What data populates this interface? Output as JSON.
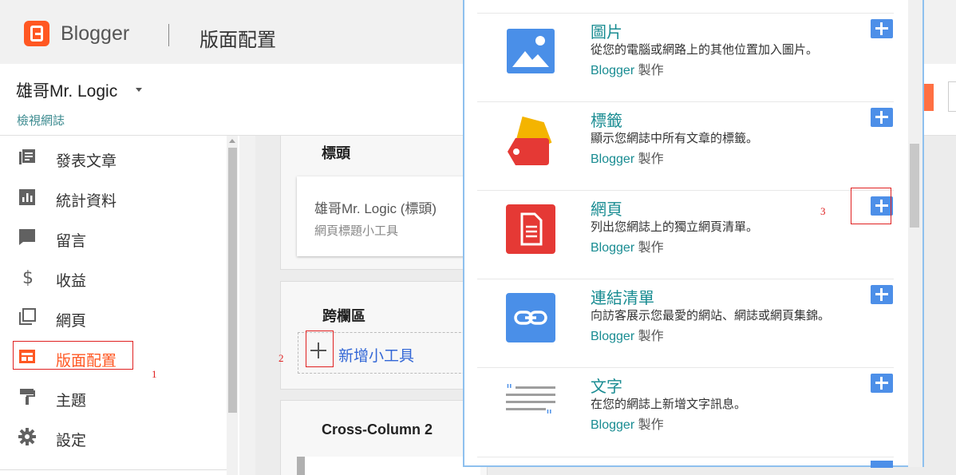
{
  "header": {
    "brand": "Blogger",
    "page_title": "版面配置"
  },
  "blog": {
    "name": "雄哥Mr. Logic",
    "view_blog": "檢視網誌"
  },
  "sidebar": {
    "items": [
      {
        "label": "發表文章",
        "icon": "posts-icon"
      },
      {
        "label": "統計資料",
        "icon": "stats-icon"
      },
      {
        "label": "留言",
        "icon": "comments-icon"
      },
      {
        "label": "收益",
        "icon": "dollar-icon"
      },
      {
        "label": "網頁",
        "icon": "pages-icon"
      },
      {
        "label": "版面配置",
        "icon": "layout-icon",
        "active": true
      },
      {
        "label": "主題",
        "icon": "theme-icon"
      },
      {
        "label": "設定",
        "icon": "gear-icon"
      }
    ]
  },
  "annotations": {
    "one": "1",
    "two": "2",
    "three": "3"
  },
  "layout": {
    "header_section": {
      "title": "標頭",
      "gadget_title": "雄哥Mr. Logic (標頭)",
      "gadget_subtitle": "網頁標題小工具"
    },
    "cross_column": {
      "title": "跨欄區",
      "add_gadget": "新增小工具"
    },
    "cross_column_2": {
      "title": "Cross-Column 2"
    }
  },
  "gadget_picker": {
    "items": [
      {
        "name": "圖片",
        "description": "從您的電腦或網路上的其他位置加入圖片。",
        "by": "Blogger",
        "made": "製作"
      },
      {
        "name": "標籤",
        "description": "顯示您網誌中所有文章的標籤。",
        "by": "Blogger",
        "made": "製作"
      },
      {
        "name": "網頁",
        "description": "列出您網誌上的獨立網頁清單。",
        "by": "Blogger",
        "made": "製作"
      },
      {
        "name": "連結清單",
        "description": "向訪客展示您最愛的網站、網誌或網頁集錦。",
        "by": "Blogger",
        "made": "製作"
      },
      {
        "name": "文字",
        "description": "在您的網誌上新增文字訊息。",
        "by": "Blogger",
        "made": "製作"
      }
    ]
  },
  "colors": {
    "accent": "#ff5722",
    "link": "#198c92",
    "add_button": "#4d8fe8",
    "annotation": "#e02020"
  }
}
